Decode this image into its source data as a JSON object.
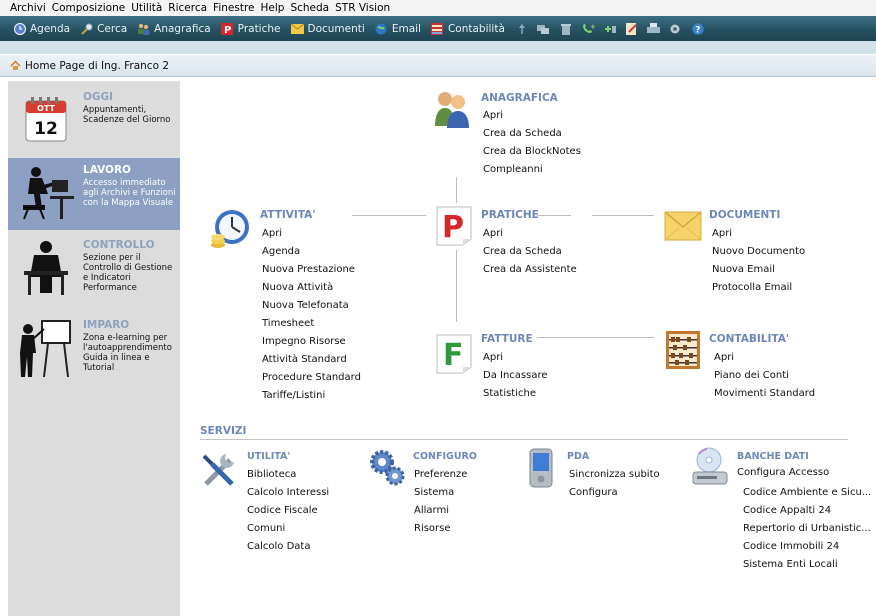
{
  "menu": [
    "Archivi",
    "Composizione",
    "Utilità",
    "Ricerca",
    "Finestre",
    "Help",
    "Scheda",
    "STR Vision"
  ],
  "toolbar": {
    "items": [
      "Agenda",
      "Cerca",
      "Anagrafica",
      "Pratiche",
      "Documenti",
      "Email",
      "Contabilità"
    ]
  },
  "window": {
    "title": "Home Page di Ing. Franco 2"
  },
  "sidebar": {
    "calendar": {
      "month": "OTT",
      "day": "12"
    },
    "items": [
      {
        "title": "OGGI",
        "desc": "Appuntamenti, Scadenze del Giorno"
      },
      {
        "title": "LAVORO",
        "desc": "Accesso immediato agli Archivi e Funzioni con la Mappa Visuale"
      },
      {
        "title": "CONTROLLO",
        "desc": "Sezione per il Controllo di Gestione e Indicatori Performance"
      },
      {
        "title": "IMPARO",
        "desc": "Zona e-learning per l'autoapprendimento Guida in linea e Tutorial"
      }
    ]
  },
  "map": {
    "anagrafica": {
      "title": "ANAGRAFICA",
      "links": [
        "Apri",
        "Crea da Scheda",
        "Crea da BlockNotes",
        "Compleanni"
      ]
    },
    "attivita": {
      "title": "ATTIVITA'",
      "links": [
        "Apri",
        "Agenda",
        "Nuova Prestazione",
        "Nuova Attività",
        "Nuova Telefonata",
        "Timesheet",
        "Impegno Risorse",
        "Attività Standard",
        "Procedure Standard",
        "Tariffe/Listini"
      ]
    },
    "pratiche": {
      "title": "PRATICHE",
      "links": [
        "Apri",
        "Crea da Scheda",
        "Crea da Assistente"
      ]
    },
    "documenti": {
      "title": "DOCUMENTI",
      "links": [
        "Apri",
        "Nuovo Documento",
        "Nuova Email",
        "Protocolla Email"
      ]
    },
    "fatture": {
      "title": "FATTURE",
      "links": [
        "Apri",
        "Da Incassare",
        "Statistiche"
      ]
    },
    "contabilita": {
      "title": "CONTABILITA'",
      "links": [
        "Apri",
        "Piano dei Conti",
        "Movimenti Standard"
      ]
    }
  },
  "servizi": {
    "title": "SERVIZI",
    "utilita": {
      "title": "UTILITA'",
      "links": [
        "Biblioteca",
        "Calcolo Interessi",
        "Codice Fiscale",
        "Comuni",
        "Calcolo Data"
      ]
    },
    "configuro": {
      "title": "CONFIGURO",
      "links": [
        "Preferenze",
        "Sistema",
        "Allarmi",
        "Risorse"
      ]
    },
    "pda": {
      "title": "PDA",
      "links": [
        "Sincronizza subito",
        "Configura"
      ]
    },
    "banche_dati": {
      "title": "BANCHE DATI",
      "head_link": "Configura Accesso",
      "links": [
        "Codice Ambiente e Sicu...",
        "Codice Appalti 24",
        "Repertorio di Urbanistic...",
        "Codice Immobili 24",
        "Sistema Enti Locali"
      ]
    }
  },
  "colors": {
    "section_title": "#6f86b8",
    "sidebar_active": "#8d9fc2",
    "toolbar": "#24505f"
  }
}
